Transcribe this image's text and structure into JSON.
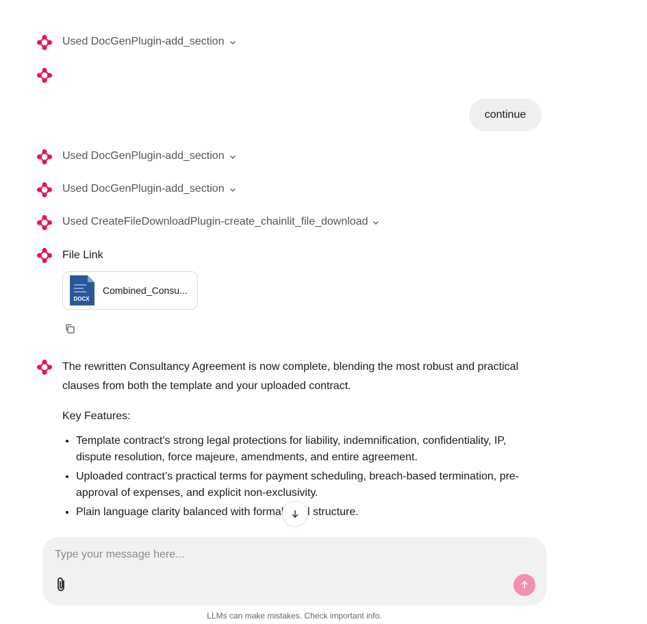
{
  "messages": {
    "tool_call_1": "Used DocGenPlugin-add_section",
    "user_message": "continue",
    "tool_call_2": "Used DocGenPlugin-add_section",
    "tool_call_3": "Used DocGenPlugin-add_section",
    "tool_call_4": "Used CreateFileDownloadPlugin-create_chainlit_file_download",
    "file_link_label": "File Link",
    "file": {
      "badge": "DOCX",
      "name": "Combined_Consu..."
    },
    "answer": {
      "intro": "The rewritten Consultancy Agreement is now complete, blending the most robust and practical clauses from both the template and your uploaded contract.",
      "key_features_label": "Key Features:",
      "bullets": [
        "Template contract’s strong legal protections for liability, indemnification, confidentiality, IP, dispute resolution, force majeure, amendments, and entire agreement.",
        "Uploaded contract’s practical terms for payment scheduling, breach-based termination, pre-approval of expenses, and explicit non-exclusivity.",
        "Plain language clarity balanced with formal legal structure."
      ]
    }
  },
  "composer": {
    "placeholder": "Type your message here..."
  },
  "disclaimer": "LLMs can make mistakes. Check important info.",
  "icons": {
    "assistant": "assistant-logo-icon",
    "chevron": "chevron-down-icon",
    "copy": "copy-icon",
    "scroll": "arrow-down-icon",
    "attach": "paperclip-icon",
    "send": "arrow-up-icon"
  },
  "colors": {
    "accent": "#e8125c",
    "send_button": "#f48fb1",
    "bubble": "#efefef",
    "composer": "#f1f1f1"
  }
}
